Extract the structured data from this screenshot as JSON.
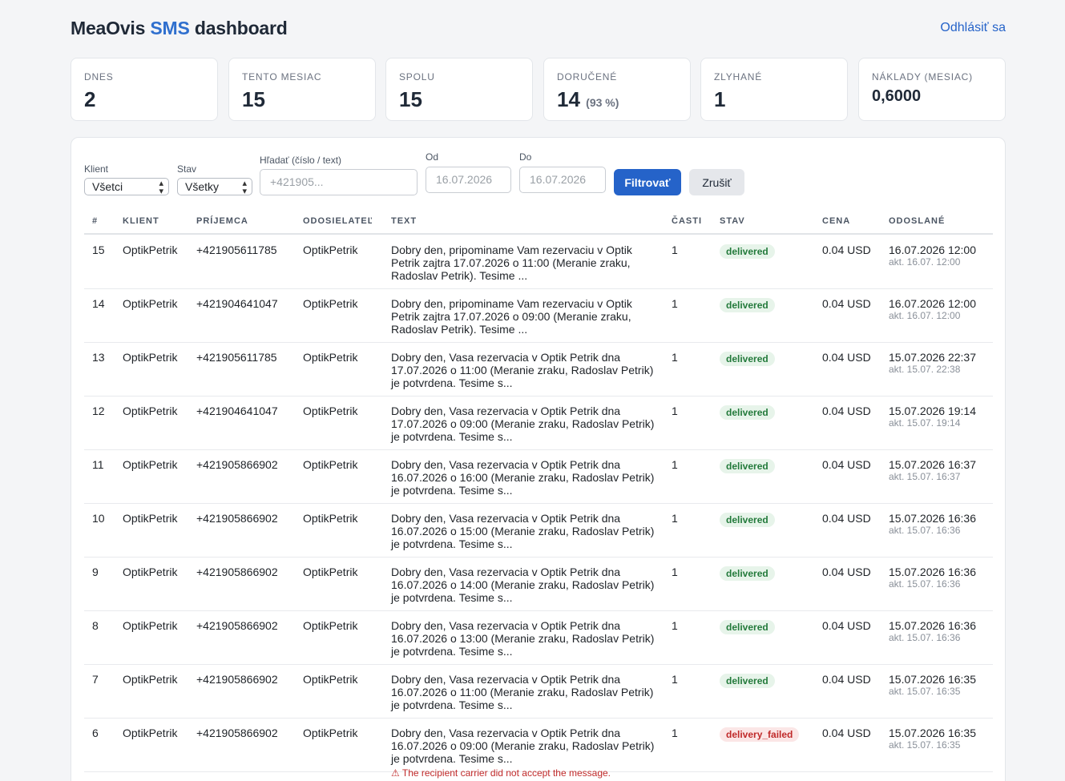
{
  "header": {
    "brand_prefix": "MeaOvis ",
    "brand_accent": "SMS",
    "brand_suffix": " dashboard",
    "logout_label": "Odhlásiť sa"
  },
  "stats": [
    {
      "label": "DNES",
      "value": "2"
    },
    {
      "label": "TENTO MESIAC",
      "value": "15"
    },
    {
      "label": "SPOLU",
      "value": "15"
    },
    {
      "label": "DORUČENÉ",
      "value": "14",
      "extra": "(93 %)"
    },
    {
      "label": "ZLYHANÉ",
      "value": "1"
    },
    {
      "label": "NÁKLADY (MESIAC)",
      "value": "0,6000"
    }
  ],
  "filters": {
    "client_label": "Klient",
    "client_value": "Všetci",
    "status_label": "Stav",
    "status_value": "Všetky",
    "search_label": "Hľadať (číslo / text)",
    "search_placeholder": "+421905...",
    "from_label": "Od",
    "from_value": "16.07.2026",
    "to_label": "Do",
    "to_value": "16.07.2026",
    "filter_button": "Filtrovať",
    "reset_button": "Zrušiť"
  },
  "table": {
    "columns": [
      "#",
      "KLIENT",
      "PRÍJEMCA",
      "ODOSIELATEĽ",
      "TEXT",
      "ČASTI",
      "STAV",
      "CENA",
      "ODOSLANÉ"
    ],
    "rows": [
      {
        "id": "15",
        "client": "OptikPetrik",
        "recipient": "+421905611785",
        "sender": "OptikPetrik",
        "text": "Dobry den, pripominame Vam rezervaciu v Optik Petrik zajtra 17.07.2026 o 11:00 (Meranie zraku, Radoslav Petrik). Tesime ...",
        "parts": "1",
        "status": "delivered",
        "price": "0.04 USD",
        "sent": "16.07.2026 12:00",
        "updated": "akt. 16.07. 12:00",
        "error": ""
      },
      {
        "id": "14",
        "client": "OptikPetrik",
        "recipient": "+421904641047",
        "sender": "OptikPetrik",
        "text": "Dobry den, pripominame Vam rezervaciu v Optik Petrik zajtra 17.07.2026 o 09:00 (Meranie zraku, Radoslav Petrik). Tesime ...",
        "parts": "1",
        "status": "delivered",
        "price": "0.04 USD",
        "sent": "16.07.2026 12:00",
        "updated": "akt. 16.07. 12:00",
        "error": ""
      },
      {
        "id": "13",
        "client": "OptikPetrik",
        "recipient": "+421905611785",
        "sender": "OptikPetrik",
        "text": "Dobry den, Vasa rezervacia v Optik Petrik dna 17.07.2026 o 11:00 (Meranie zraku, Radoslav Petrik) je potvrdena. Tesime s...",
        "parts": "1",
        "status": "delivered",
        "price": "0.04 USD",
        "sent": "15.07.2026 22:37",
        "updated": "akt. 15.07. 22:38",
        "error": ""
      },
      {
        "id": "12",
        "client": "OptikPetrik",
        "recipient": "+421904641047",
        "sender": "OptikPetrik",
        "text": "Dobry den, Vasa rezervacia v Optik Petrik dna 17.07.2026 o 09:00 (Meranie zraku, Radoslav Petrik) je potvrdena. Tesime s...",
        "parts": "1",
        "status": "delivered",
        "price": "0.04 USD",
        "sent": "15.07.2026 19:14",
        "updated": "akt. 15.07. 19:14",
        "error": ""
      },
      {
        "id": "11",
        "client": "OptikPetrik",
        "recipient": "+421905866902",
        "sender": "OptikPetrik",
        "text": "Dobry den, Vasa rezervacia v Optik Petrik dna 16.07.2026 o 16:00 (Meranie zraku, Radoslav Petrik) je potvrdena. Tesime s...",
        "parts": "1",
        "status": "delivered",
        "price": "0.04 USD",
        "sent": "15.07.2026 16:37",
        "updated": "akt. 15.07. 16:37",
        "error": ""
      },
      {
        "id": "10",
        "client": "OptikPetrik",
        "recipient": "+421905866902",
        "sender": "OptikPetrik",
        "text": "Dobry den, Vasa rezervacia v Optik Petrik dna 16.07.2026 o 15:00 (Meranie zraku, Radoslav Petrik) je potvrdena. Tesime s...",
        "parts": "1",
        "status": "delivered",
        "price": "0.04 USD",
        "sent": "15.07.2026 16:36",
        "updated": "akt. 15.07. 16:36",
        "error": ""
      },
      {
        "id": "9",
        "client": "OptikPetrik",
        "recipient": "+421905866902",
        "sender": "OptikPetrik",
        "text": "Dobry den, Vasa rezervacia v Optik Petrik dna 16.07.2026 o 14:00 (Meranie zraku, Radoslav Petrik) je potvrdena. Tesime s...",
        "parts": "1",
        "status": "delivered",
        "price": "0.04 USD",
        "sent": "15.07.2026 16:36",
        "updated": "akt. 15.07. 16:36",
        "error": ""
      },
      {
        "id": "8",
        "client": "OptikPetrik",
        "recipient": "+421905866902",
        "sender": "OptikPetrik",
        "text": "Dobry den, Vasa rezervacia v Optik Petrik dna 16.07.2026 o 13:00 (Meranie zraku, Radoslav Petrik) je potvrdena. Tesime s...",
        "parts": "1",
        "status": "delivered",
        "price": "0.04 USD",
        "sent": "15.07.2026 16:36",
        "updated": "akt. 15.07. 16:36",
        "error": ""
      },
      {
        "id": "7",
        "client": "OptikPetrik",
        "recipient": "+421905866902",
        "sender": "OptikPetrik",
        "text": "Dobry den, Vasa rezervacia v Optik Petrik dna 16.07.2026 o 11:00 (Meranie zraku, Radoslav Petrik) je potvrdena. Tesime s...",
        "parts": "1",
        "status": "delivered",
        "price": "0.04 USD",
        "sent": "15.07.2026 16:35",
        "updated": "akt. 15.07. 16:35",
        "error": ""
      },
      {
        "id": "6",
        "client": "OptikPetrik",
        "recipient": "+421905866902",
        "sender": "OptikPetrik",
        "text": "Dobry den, Vasa rezervacia v Optik Petrik dna 16.07.2026 o 09:00 (Meranie zraku, Radoslav Petrik) je potvrdena. Tesime s...",
        "parts": "1",
        "status": "delivery_failed",
        "price": "0.04 USD",
        "sent": "15.07.2026 16:35",
        "updated": "akt. 15.07. 16:35",
        "error": "⚠ The recipient carrier did not accept the message."
      }
    ]
  }
}
